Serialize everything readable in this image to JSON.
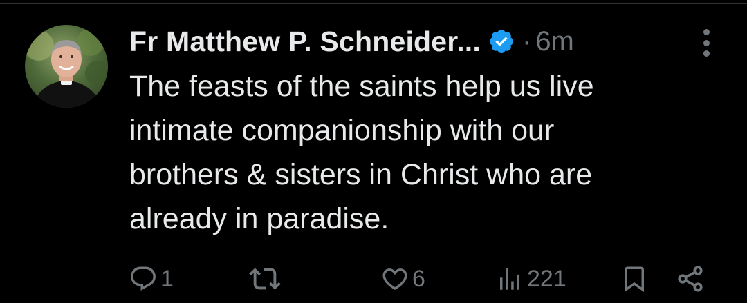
{
  "tweet": {
    "author_name": "Fr Matthew P. Schneider...",
    "separator": "·",
    "timestamp": "6m",
    "text_lines": [
      "The feasts of the saints help us live",
      "intimate companionship with our",
      "brothers & sisters in Christ who are",
      "already in paradise."
    ]
  },
  "actions": {
    "reply_count": "1",
    "repost_count": "",
    "like_count": "6",
    "views_count": "221"
  },
  "icons": {
    "verified": "verified-check-icon",
    "more": "more-vertical-icon",
    "reply": "reply-bubble-icon",
    "repost": "repost-icon",
    "like": "heart-icon",
    "views": "views-bar-chart-icon",
    "bookmark": "bookmark-icon",
    "share": "share-icon"
  },
  "colors": {
    "background": "#000000",
    "text_primary": "#e7e9ea",
    "text_secondary": "#71767b",
    "verified_blue": "#1d9bf0"
  }
}
